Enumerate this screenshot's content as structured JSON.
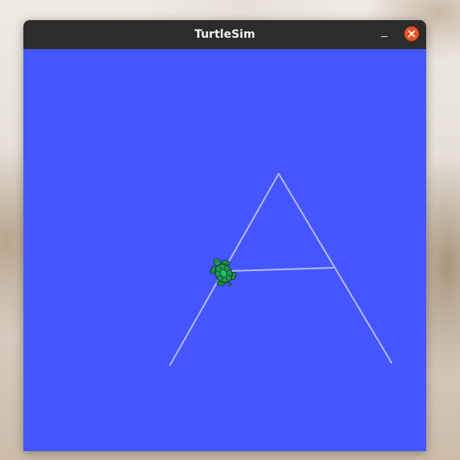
{
  "window": {
    "title": "TurtleSim"
  },
  "titlebar": {
    "minimize_icon": "minimize-icon",
    "close_icon": "close-icon",
    "close_color": "#e95420"
  },
  "canvas": {
    "background_color": "#4556ff",
    "pen_color": "#b3b8ff",
    "turtle_icon": "turtle-icon"
  }
}
